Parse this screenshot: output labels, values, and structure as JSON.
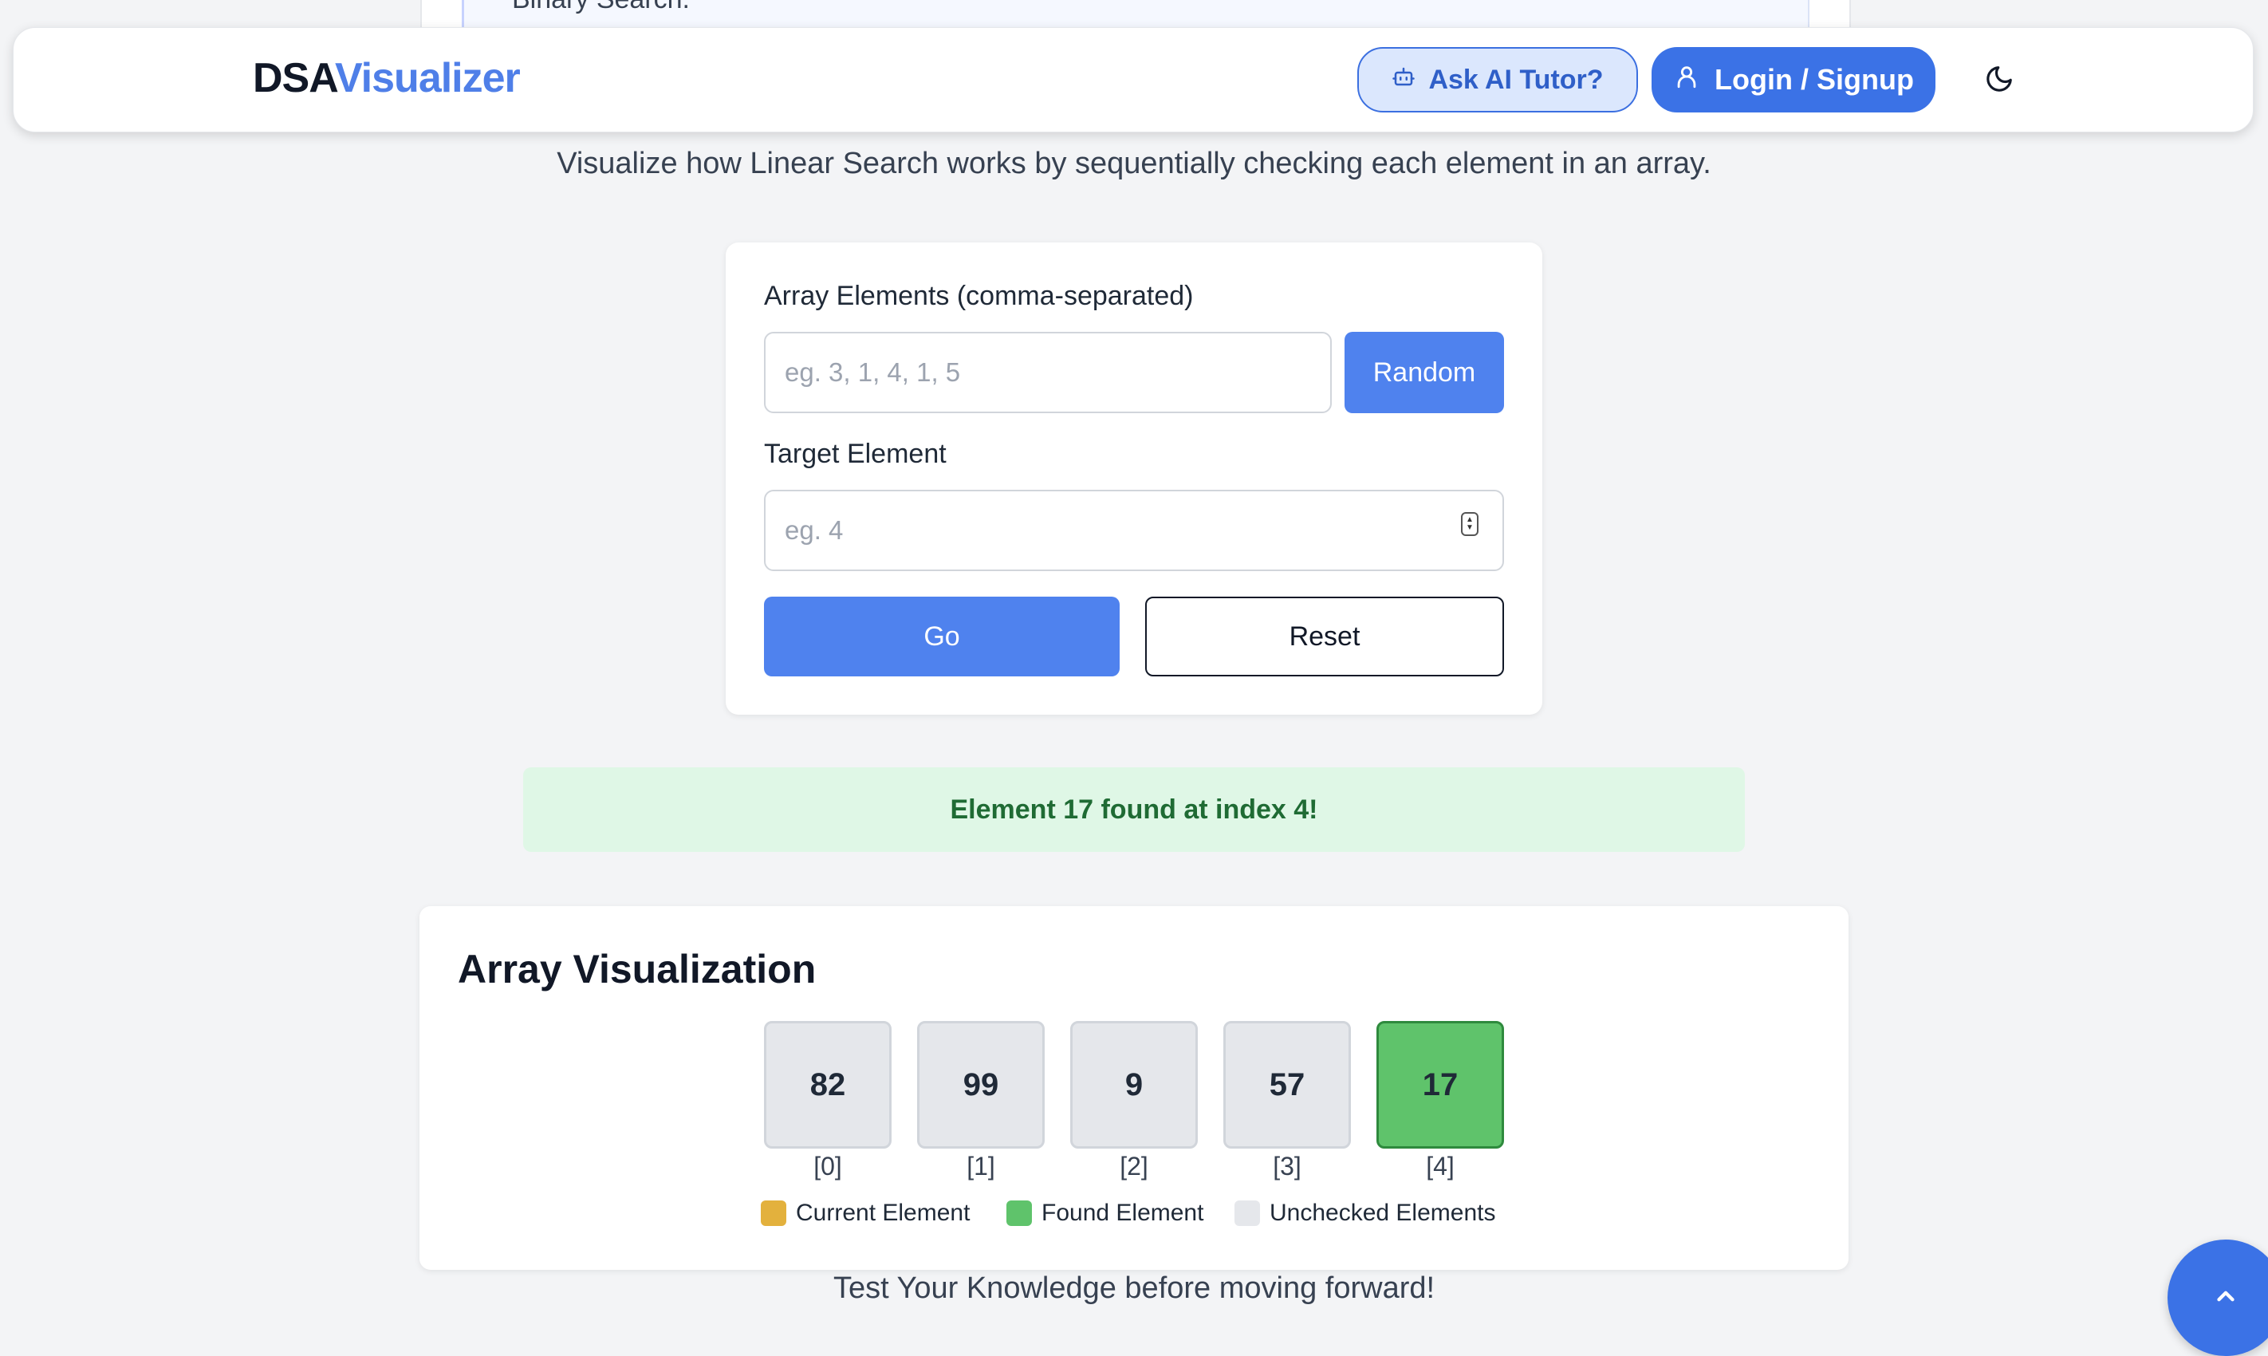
{
  "page": {
    "partial_heading": "Binary Search.",
    "subtitle": "Visualize how Linear Search works by sequentially checking each element in an array."
  },
  "navbar": {
    "logo_dsa": "DSA",
    "logo_visualizer": "Visualizer",
    "tutor_label": "Ask AI Tutor?",
    "login_label": "Login / Signup",
    "icons": {
      "tutor": "robot-icon",
      "login": "user-icon",
      "theme": "moon-icon"
    }
  },
  "form": {
    "array_label": "Array Elements (comma-separated)",
    "array_placeholder": "eg. 3, 1, 4, 1, 5",
    "array_value": "",
    "random_label": "Random",
    "target_label": "Target Element",
    "target_placeholder": "eg. 4",
    "target_value": "",
    "go_label": "Go",
    "reset_label": "Reset"
  },
  "result": {
    "message": "Element 17 found at index 4!"
  },
  "visualization": {
    "title": "Array Visualization",
    "cells": [
      {
        "value": "82",
        "index": "[0]",
        "state": "unchecked"
      },
      {
        "value": "99",
        "index": "[1]",
        "state": "unchecked"
      },
      {
        "value": "9",
        "index": "[2]",
        "state": "unchecked"
      },
      {
        "value": "57",
        "index": "[3]",
        "state": "unchecked"
      },
      {
        "value": "17",
        "index": "[4]",
        "state": "found"
      }
    ],
    "legend": [
      {
        "label": "Current Element",
        "color": "#e3b13d"
      },
      {
        "label": "Found Element",
        "color": "#5fc36b"
      },
      {
        "label": "Unchecked Elements",
        "color": "#e5e7eb"
      }
    ]
  },
  "footer": {
    "knowledge": "Test Your Knowledge before moving forward!",
    "scroll_top_icon": "chevron-up-icon"
  },
  "colors": {
    "accent": "#3b72e6",
    "found": "#5fc36b",
    "current": "#e3b13d",
    "unchecked": "#e5e7eb"
  }
}
